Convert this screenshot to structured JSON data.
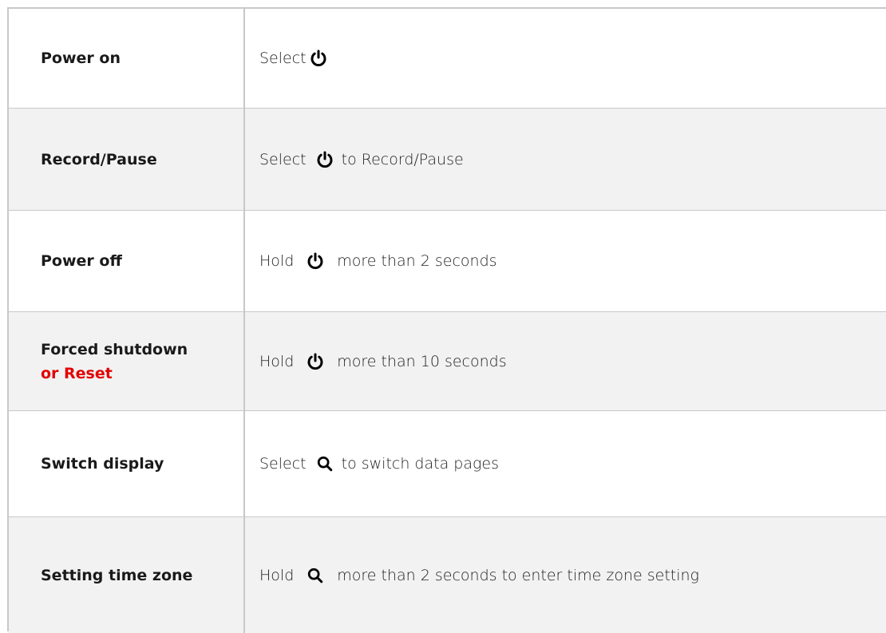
{
  "rows": [
    {
      "action": "Power on",
      "before": "Select",
      "icon": "power-icon",
      "after": ""
    },
    {
      "action": "Record/Pause",
      "before": "Select",
      "icon": "power-icon",
      "after": "to Record/Pause"
    },
    {
      "action": "Power off",
      "before": "Hold",
      "icon": "power-icon",
      "after": "more than 2 seconds"
    },
    {
      "action": "Forced shutdown",
      "action_extra": "or Reset",
      "before": "Hold",
      "icon": "power-icon",
      "after": "more than 10 seconds"
    },
    {
      "action": "Switch display",
      "before": "Select",
      "icon": "search-icon",
      "after": "to switch data pages"
    },
    {
      "action": "Setting time zone",
      "before": "Hold",
      "icon": "search-icon",
      "after": "more than 2 seconds to enter time zone setting"
    }
  ],
  "colors": {
    "accent_red": "#e30000",
    "alt_row": "#f2f2f2",
    "border": "#c8c8c8"
  }
}
